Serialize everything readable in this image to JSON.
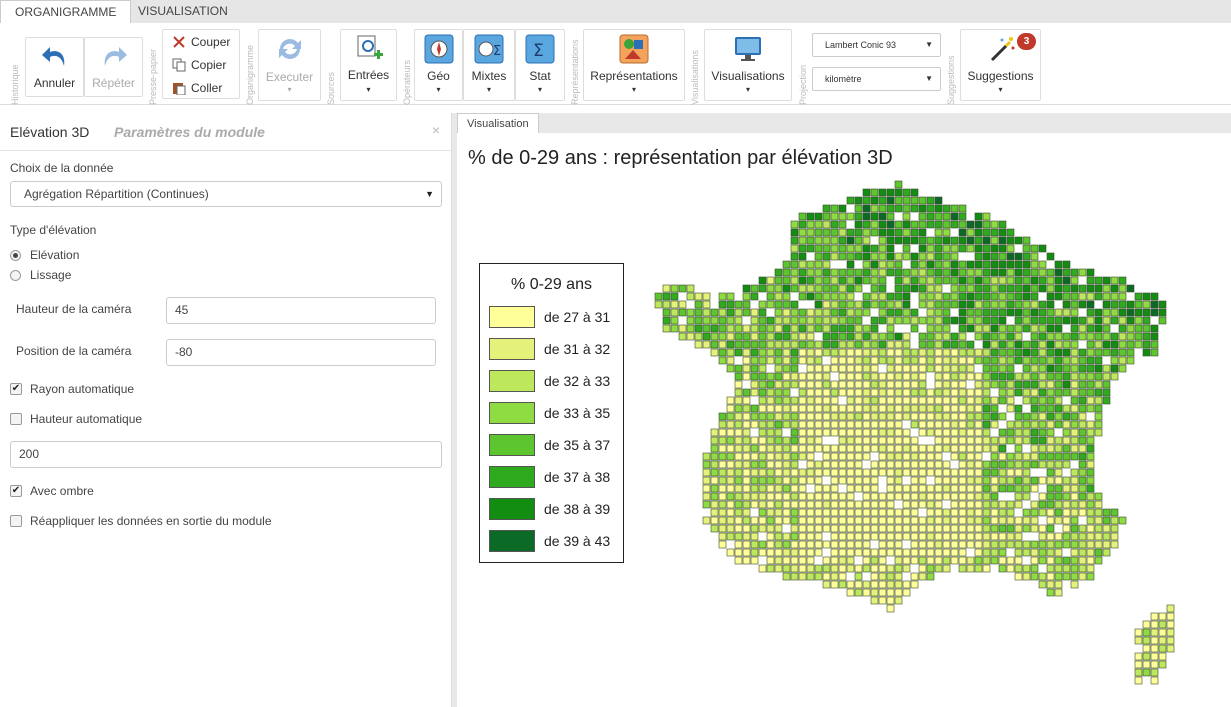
{
  "tabs": [
    {
      "label": "ORGANIGRAMME",
      "active": true
    },
    {
      "label": "VISUALISATION",
      "active": false
    }
  ],
  "ribbon": {
    "groups": {
      "historique": "Historique",
      "presse_papier": "Presse-papier",
      "organigramme": "Organigramme",
      "sources": "Sources",
      "operateurs": "Opérateurs",
      "representations": "Représentations",
      "visualisations": "Visualisations",
      "projection": "Projection",
      "suggestions": "Suggestions"
    },
    "annuler": "Annuler",
    "repeter": "Répéter",
    "couper": "Couper",
    "copier": "Copier",
    "coller": "Coller",
    "executer": "Executer",
    "entrees": "Entrées",
    "geo": "Géo",
    "mixtes": "Mixtes",
    "stat": "Stat",
    "representations": "Représentations",
    "visualisations": "Visualisations",
    "projection_select": "Lambert Conic 93",
    "unit_select": "kilomètre",
    "suggestions": "Suggestions",
    "suggestions_count": "3",
    "caret": "▾",
    "select_caret": "▼"
  },
  "panel": {
    "title": "Elévation 3D",
    "subtitle": "Paramètres du module",
    "close": "×",
    "choix_label": "Choix de la donnée",
    "choix_value": "Agrégation Répartition (Continues)",
    "select_caret": "▼",
    "type_label": "Type d'élévation",
    "opt_elevation": "Elévation",
    "opt_lissage": "Lissage",
    "hauteur_camera_label": "Hauteur de la caméra",
    "hauteur_camera_value": "45",
    "position_camera_label": "Position de la caméra",
    "position_camera_value": "-80",
    "rayon_auto_label": "Rayon automatique",
    "rayon_auto_checked": true,
    "hauteur_auto_label": "Hauteur automatique",
    "hauteur_auto_checked": false,
    "rayon_value": "200",
    "ombre_label": "Avec ombre",
    "ombre_checked": true,
    "reappliquer_label": "Réappliquer les données en sortie du module",
    "reappliquer_checked": false,
    "check_glyph": "✔"
  },
  "visualisation": {
    "tab": "Visualisation",
    "title": "% de 0-29 ans : représentation par élévation 3D",
    "legend_title": "% 0-29 ans",
    "legend": [
      {
        "label": "de 27 à 31",
        "color": "#ffff99"
      },
      {
        "label": "de 31 à 32",
        "color": "#e4f27a"
      },
      {
        "label": "de 32 à 33",
        "color": "#bde85c"
      },
      {
        "label": "de 33 à 35",
        "color": "#8edc41"
      },
      {
        "label": "de 35 à 37",
        "color": "#5dc62e"
      },
      {
        "label": "de 37 à 38",
        "color": "#2faa1e"
      },
      {
        "label": "de 38 à 39",
        "color": "#138c12"
      },
      {
        "label": "de 39 à 43",
        "color": "#0b6a25"
      }
    ]
  }
}
